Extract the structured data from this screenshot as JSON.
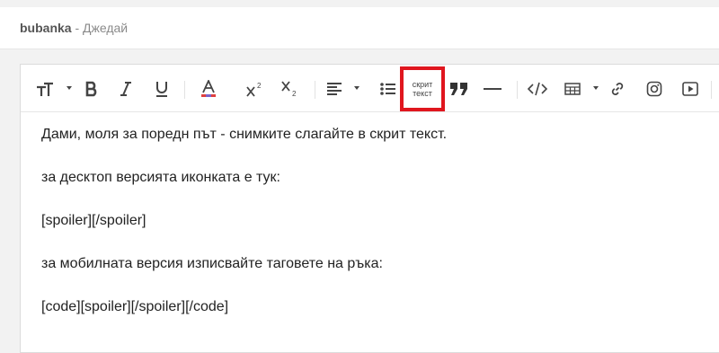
{
  "breadcrumb": {
    "user": "bubanka",
    "separator": " - ",
    "name": "Джедай"
  },
  "toolbar": {
    "spoiler_button_line1": "скрит",
    "spoiler_button_line2": "текст",
    "highlight_color": "#e0161e"
  },
  "content": {
    "lines": [
      "Дами, моля за поредн път - снимките слагайте в скрит текст.",
      "за десктоп версията иконката е тук:",
      "[spoiler][/spoiler]",
      "за мобилната версия изписвайте таговете на ръка:",
      "[code][spoiler][/spoiler][/code]"
    ]
  }
}
